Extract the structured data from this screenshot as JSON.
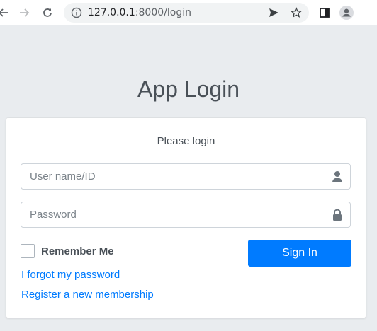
{
  "browser": {
    "url_host": "127.0.0.1",
    "url_rest": ":8000/login"
  },
  "page": {
    "title": "App Login"
  },
  "login": {
    "message": "Please login",
    "username_placeholder": "User name/ID",
    "username_value": "",
    "password_placeholder": "Password",
    "password_value": "",
    "remember_label": "Remember Me",
    "remember_checked": false,
    "signin_label": "Sign In",
    "forgot_link": "I forgot my password",
    "register_link": "Register a new membership"
  },
  "colors": {
    "background": "#e9ecef",
    "primary": "#007bff",
    "text": "#495057"
  },
  "icons": {
    "back": "arrow-left-icon",
    "forward": "arrow-right-icon",
    "reload": "reload-icon",
    "info": "info-icon",
    "send": "send-icon",
    "bookmark": "star-icon",
    "sidepanel": "side-panel-icon",
    "profile": "profile-avatar-icon",
    "user": "user-icon",
    "lock": "lock-icon"
  }
}
